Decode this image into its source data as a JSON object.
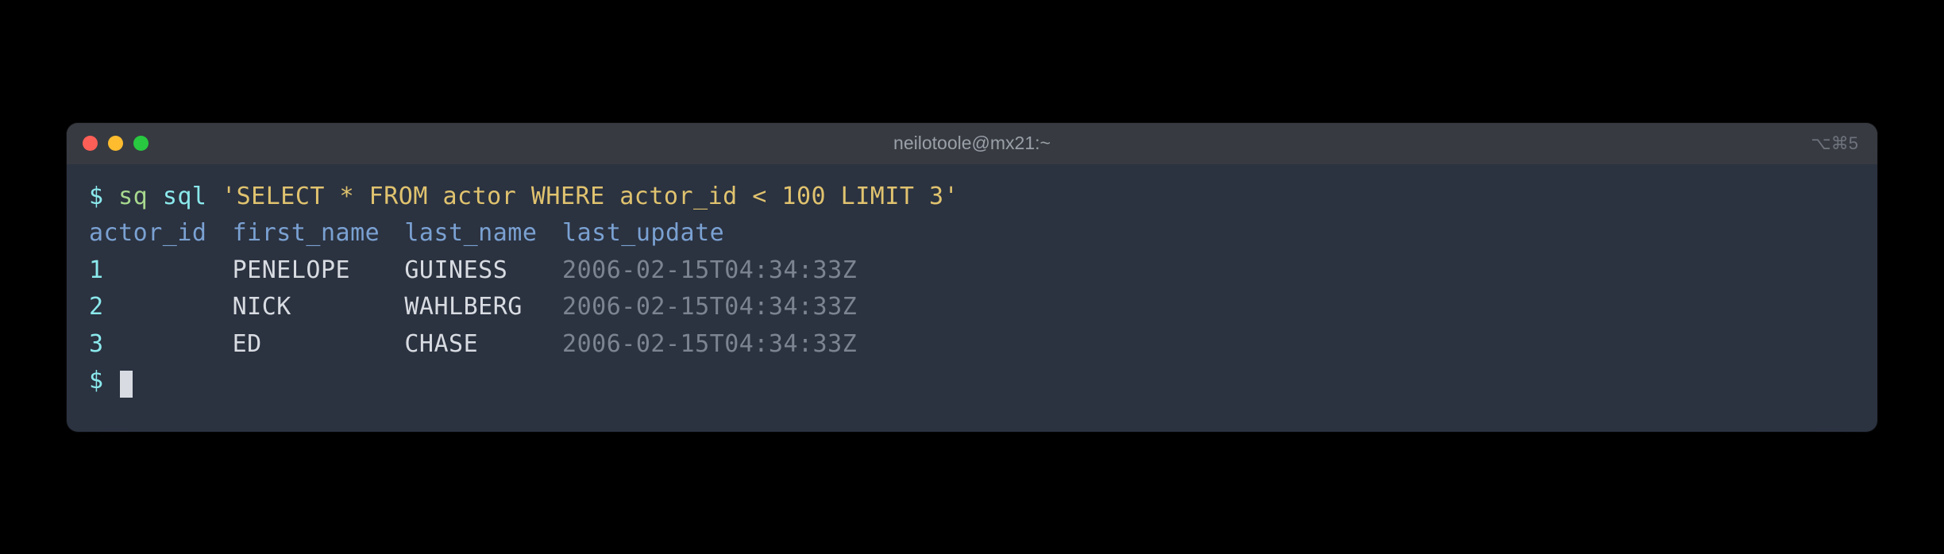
{
  "window": {
    "title": "neilotoole@mx21:~",
    "shortcut_hint": "⌥⌘5"
  },
  "prompt_symbol": "$",
  "command": {
    "prog": "sq",
    "sub": "sql",
    "arg": "'SELECT * FROM actor WHERE actor_id < 100 LIMIT 3'"
  },
  "headers": {
    "c0": "actor_id",
    "c1": "first_name",
    "c2": "last_name",
    "c3": "last_update"
  },
  "rows": [
    {
      "c0": "1",
      "c1": "PENELOPE",
      "c2": "GUINESS",
      "c3": "2006-02-15T04:34:33Z"
    },
    {
      "c0": "2",
      "c1": "NICK",
      "c2": "WAHLBERG",
      "c3": "2006-02-15T04:34:33Z"
    },
    {
      "c0": "3",
      "c1": "ED",
      "c2": "CHASE",
      "c3": "2006-02-15T04:34:33Z"
    }
  ]
}
